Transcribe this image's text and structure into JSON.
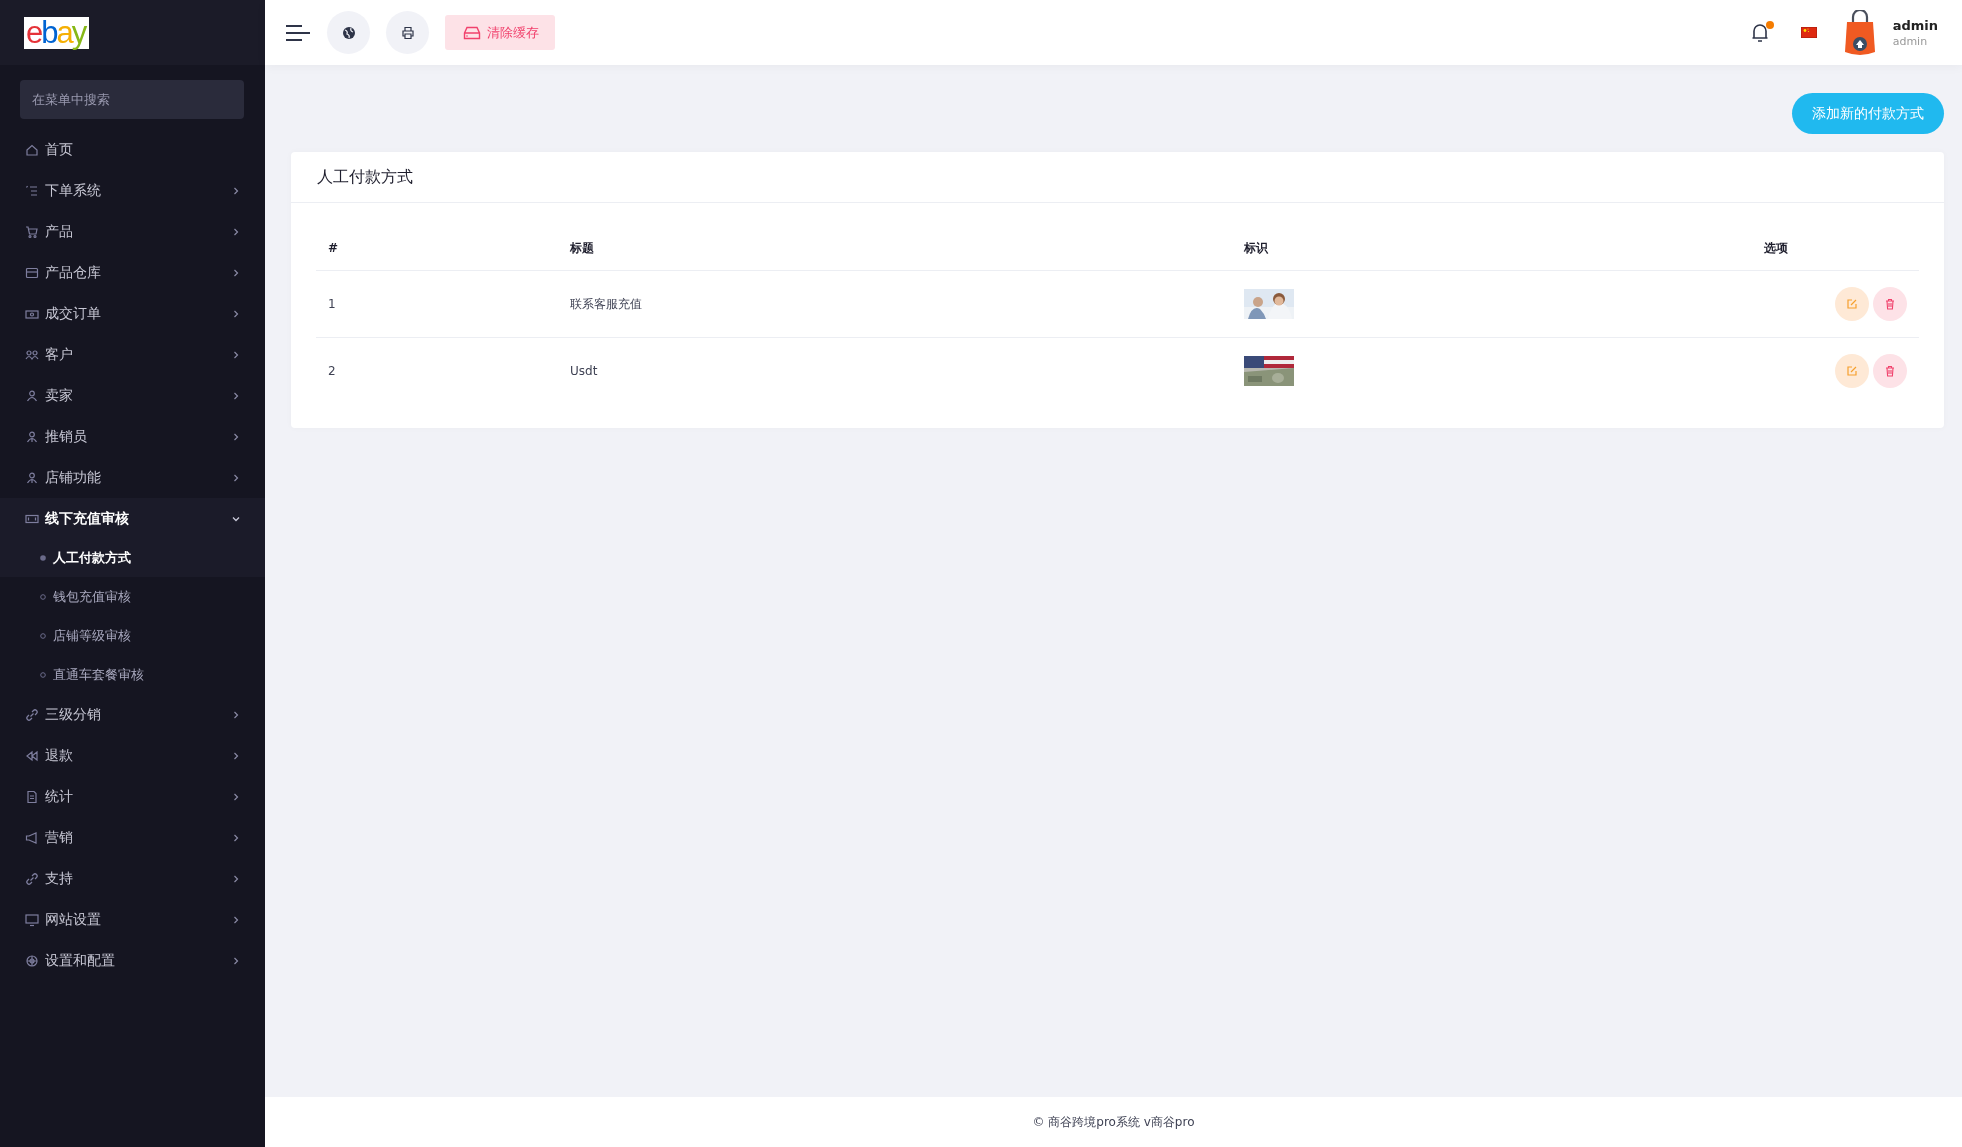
{
  "logo": "ebay",
  "sidebar": {
    "search": {
      "placeholder": "在菜单中搜索"
    },
    "items": [
      {
        "label": "首页"
      },
      {
        "label": "下单系统",
        "expanded": false
      },
      {
        "label": "产品",
        "expanded": false
      },
      {
        "label": "产品仓库",
        "expanded": false
      },
      {
        "label": "成交订单",
        "expanded": false
      },
      {
        "label": "客户",
        "expanded": false
      },
      {
        "label": "卖家",
        "expanded": false
      },
      {
        "label": "推销员",
        "expanded": false
      },
      {
        "label": "店铺功能",
        "expanded": false
      },
      {
        "label": "线下充值审核",
        "expanded": true,
        "children": [
          {
            "label": "人工付款方式",
            "selected": true
          },
          {
            "label": "钱包充值审核",
            "selected": false
          },
          {
            "label": "店铺等级审核",
            "selected": false
          },
          {
            "label": "直通车套餐审核",
            "selected": false
          }
        ]
      },
      {
        "label": "三级分销",
        "expanded": false
      },
      {
        "label": "退款",
        "expanded": false
      },
      {
        "label": "统计",
        "expanded": false
      },
      {
        "label": "营销",
        "expanded": false
      },
      {
        "label": "支持",
        "expanded": false
      },
      {
        "label": "网站设置",
        "expanded": false
      },
      {
        "label": "设置和配置",
        "expanded": false
      }
    ]
  },
  "header": {
    "clear_cache": "清除缓存",
    "notifications": true,
    "user": {
      "name": "admin",
      "role": "admin"
    }
  },
  "add_button": "添加新的付款方式",
  "card": {
    "title": "人工付款方式",
    "table": {
      "columns": [
        "#",
        "标题",
        "标识",
        "选项"
      ],
      "rows": [
        {
          "number": "1",
          "title": "联系客服充值"
        },
        {
          "number": "2",
          "title": "Usdt"
        }
      ]
    }
  },
  "footer": "© 商谷跨境pro系统 v商谷pro"
}
